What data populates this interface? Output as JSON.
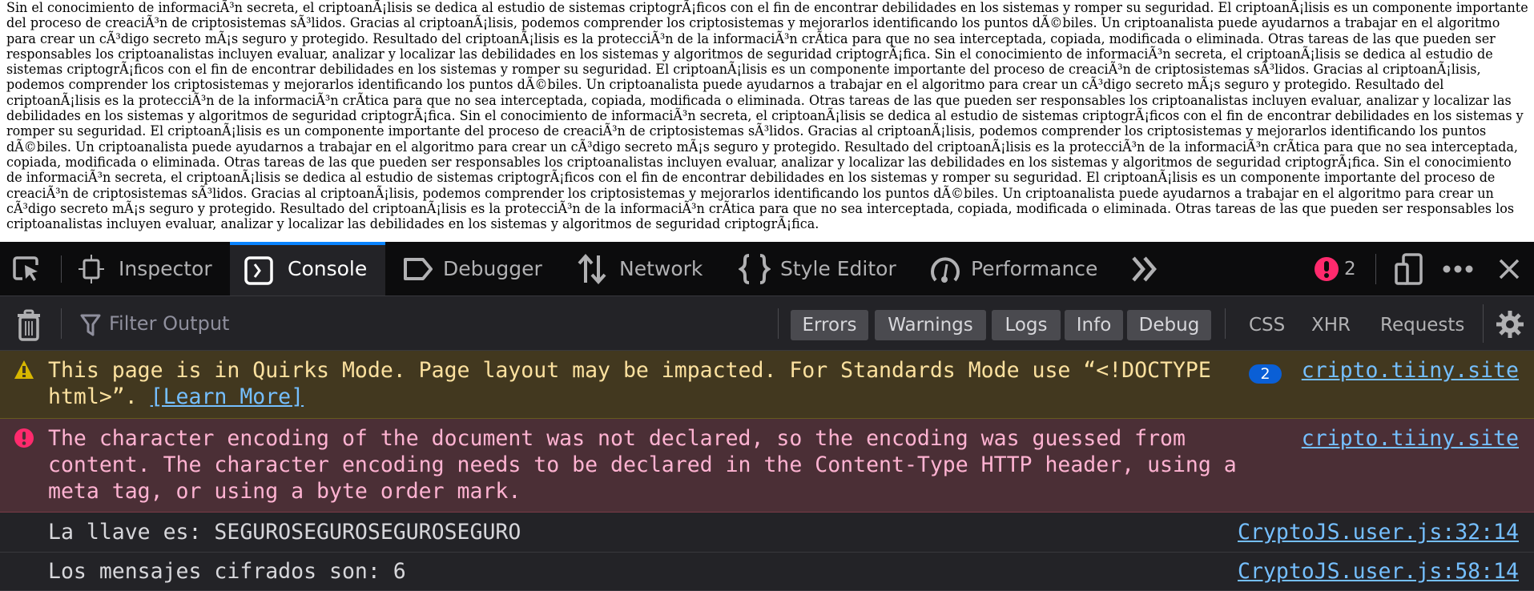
{
  "document": {
    "lines": [
      "Sin el conocimiento de informaciÃ³n secreta, el criptoanÃ¡lisis se dedica al estudio de sistemas criptogrÃ¡ficos con el fin de encontrar debilidades en los sistemas y romper su seguridad. El criptoanÃ¡lisis es un componente importante",
      "del proceso de creaciÃ³n de criptosistemas sÃ³lidos. Gracias al criptoanÃ¡lisis, podemos comprender los criptosistemas y mejorarlos identificando los puntos dÃ©biles. Un criptoanalista puede ayudarnos a trabajar en el algoritmo",
      "para crear un cÃ³digo secreto mÃ¡s seguro y protegido. Resultado del criptoanÃ¡lisis es la protecciÃ³n de la informaciÃ³n crÃtica para que no sea interceptada, copiada, modificada o eliminada. Otras tareas de las que pueden ser",
      "responsables los criptoanalistas incluyen evaluar, analizar y localizar las debilidades en los sistemas y algoritmos de seguridad criptogrÃ¡fica. Sin el conocimiento de informaciÃ³n secreta, el criptoanÃ¡lisis se dedica al estudio de",
      "sistemas criptogrÃ¡ficos con el fin de encontrar debilidades en los sistemas y romper su seguridad. El criptoanÃ¡lisis es un componente importante del proceso de creaciÃ³n de criptosistemas sÃ³lidos. Gracias al criptoanÃ¡lisis,",
      "podemos comprender los criptosistemas y mejorarlos identificando los puntos dÃ©biles. Un criptoanalista puede ayudarnos a trabajar en el algoritmo para crear un cÃ³digo secreto mÃ¡s seguro y protegido. Resultado del",
      "criptoanÃ¡lisis es la protecciÃ³n de la informaciÃ³n crÃtica para que no sea interceptada, copiada, modificada o eliminada. Otras tareas de las que pueden ser responsables los criptoanalistas incluyen evaluar, analizar y localizar las",
      "debilidades en los sistemas y algoritmos de seguridad criptogrÃ¡fica. Sin el conocimiento de informaciÃ³n secreta, el criptoanÃ¡lisis se dedica al estudio de sistemas criptogrÃ¡ficos con el fin de encontrar debilidades en los sistemas y",
      "romper su seguridad. El criptoanÃ¡lisis es un componente importante del proceso de creaciÃ³n de criptosistemas sÃ³lidos. Gracias al criptoanÃ¡lisis, podemos comprender los criptosistemas y mejorarlos identificando los puntos",
      "dÃ©biles. Un criptoanalista puede ayudarnos a trabajar en el algoritmo para crear un cÃ³digo secreto mÃ¡s seguro y protegido. Resultado del criptoanÃ¡lisis es la protecciÃ³n de la informaciÃ³n crÃtica para que no sea interceptada,",
      "copiada, modificada o eliminada. Otras tareas de las que pueden ser responsables los criptoanalistas incluyen evaluar, analizar y localizar las debilidades en los sistemas y algoritmos de seguridad criptogrÃ¡fica. Sin el conocimiento",
      "de informaciÃ³n secreta, el criptoanÃ¡lisis se dedica al estudio de sistemas criptogrÃ¡ficos con el fin de encontrar debilidades en los sistemas y romper su seguridad. El criptoanÃ¡lisis es un componente importante del proceso de",
      "creaciÃ³n de criptosistemas sÃ³lidos. Gracias al criptoanÃ¡lisis, podemos comprender los criptosistemas y mejorarlos identificando los puntos dÃ©biles. Un criptoanalista puede ayudarnos a trabajar en el algoritmo para crear un",
      "cÃ³digo secreto mÃ¡s seguro y protegido. Resultado del criptoanÃ¡lisis es la protecciÃ³n de la informaciÃ³n crÃtica para que no sea interceptada, copiada, modificada o eliminada. Otras tareas de las que pueden ser responsables los",
      "criptoanalistas incluyen evaluar, analizar y localizar las debilidades en los sistemas y algoritmos de seguridad criptogrÃ¡fica."
    ]
  },
  "devtools": {
    "tabs": {
      "inspector": "Inspector",
      "console": "Console",
      "debugger": "Debugger",
      "network": "Network",
      "style_editor": "Style Editor",
      "performance": "Performance"
    },
    "error_count": "2",
    "toolbar": {
      "filter_placeholder": "Filter Output",
      "filters": [
        "Errors",
        "Warnings",
        "Logs",
        "Info",
        "Debug"
      ],
      "css": "CSS",
      "xhr": "XHR",
      "requests": "Requests"
    },
    "messages": {
      "warning": {
        "text": "This page is in Quirks Mode. Page layout may be impacted. For Standards Mode use “<!DOCTYPE html>”. ",
        "link": "[Learn More]",
        "repeat": "2",
        "source": "cripto.tiiny.site"
      },
      "error": {
        "text": "The character encoding of the document was not declared, so the encoding was guessed from content. The character encoding needs to be declared in the Content-Type HTTP header, using a meta tag, or using a byte order mark.",
        "source": "cripto.tiiny.site"
      },
      "logs": [
        {
          "text": "La llave es: SEGUROSEGUROSEGUROSEGURO",
          "source": "CryptoJS.user.js:32:14"
        },
        {
          "text": "Los mensajes cifrados son: 6",
          "source": "CryptoJS.user.js:58:14"
        }
      ]
    },
    "colors": {
      "accent": "#0a84ff",
      "warning": "#fce19f",
      "error": "#ffb3d2",
      "link": "#75bfff",
      "error_icon": "#ff2a6d",
      "warning_icon": "#d7b600"
    }
  }
}
